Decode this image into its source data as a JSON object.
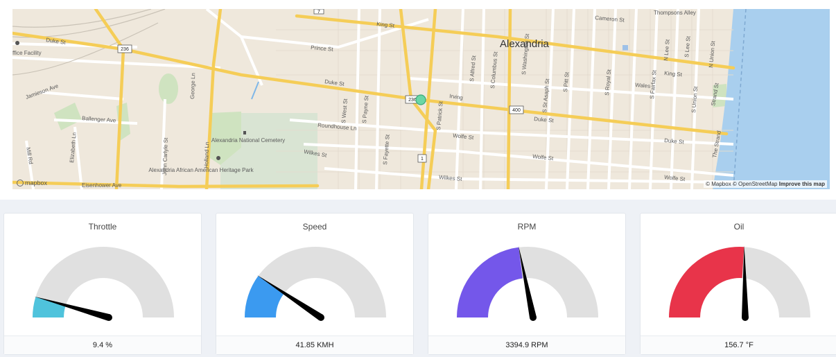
{
  "map": {
    "city_label": "Alexandria",
    "streets": [
      "Duke St",
      "King St",
      "Prince St",
      "Cameron St",
      "Wolfe St",
      "Wilkes St",
      "Irving",
      "Wales",
      "Roundhouse Ln",
      "Ballenger Ave",
      "Jamieson Ave",
      "Elizabeth Ln",
      "Mill Rd",
      "Eisenhower Ave",
      "John Carlyle St",
      "George Ln",
      "Holland Ln",
      "S West St",
      "S Payne St",
      "S Fayette St",
      "S Patrick St",
      "S Alfred St",
      "S Columbus St",
      "S Washington St",
      "S St Asaph St",
      "S Pitt St",
      "S Royal St",
      "S Fairfax St",
      "S Lee St",
      "S Union St",
      "N Union St",
      "N Lee St",
      "The Strand",
      "Strand St",
      "Thompsons Alley",
      "ffice Facility"
    ],
    "route_shields": [
      "236",
      "236",
      "1",
      "400",
      "7"
    ],
    "poi_cemetery": "Alexandria National Cemetery",
    "poi_heritage": "Alexandria African American Heritage Park",
    "attribution": "© Mapbox © OpenStreetMap",
    "improve_link": "Improve this map",
    "logo_text": "mapbox"
  },
  "gauges": [
    {
      "title": "Throttle",
      "value_text": "9.4 %",
      "fraction": 0.094,
      "color": "#4fc3dc"
    },
    {
      "title": "Speed",
      "value_text": "41.85 KMH",
      "fraction": 0.2,
      "color": "#3b9af0"
    },
    {
      "title": "RPM",
      "value_text": "3394.9 RPM",
      "fraction": 0.46,
      "color": "#7457ea"
    },
    {
      "title": "Oil",
      "value_text": "156.7 °F",
      "fraction": 0.52,
      "color": "#e8344a"
    }
  ]
}
